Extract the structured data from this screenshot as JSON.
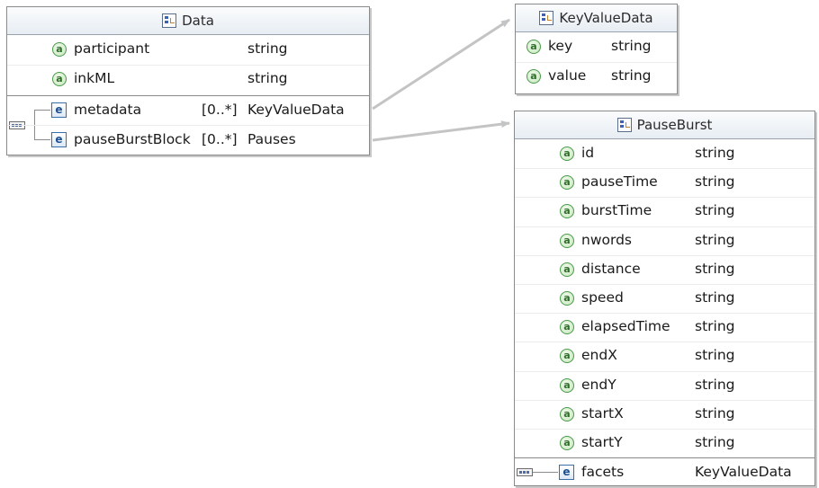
{
  "data_box": {
    "title": "Data",
    "attributes": [
      {
        "name": "participant",
        "type": "string"
      },
      {
        "name": "inkML",
        "type": "string"
      }
    ],
    "elements": [
      {
        "name": "metadata",
        "card": "[0..*]",
        "type": "KeyValueData"
      },
      {
        "name": "pauseBurstBlock",
        "card": "[0..*]",
        "type": "Pauses"
      }
    ]
  },
  "keyvalue_box": {
    "title": "KeyValueData",
    "attributes": [
      {
        "name": "key",
        "type": "string"
      },
      {
        "name": "value",
        "type": "string"
      }
    ]
  },
  "pauseburst_box": {
    "title": "PauseBurst",
    "attributes": [
      {
        "name": "id",
        "type": "string"
      },
      {
        "name": "pauseTime",
        "type": "string"
      },
      {
        "name": "burstTime",
        "type": "string"
      },
      {
        "name": "nwords",
        "type": "string"
      },
      {
        "name": "distance",
        "type": "string"
      },
      {
        "name": "speed",
        "type": "string"
      },
      {
        "name": "elapsedTime",
        "type": "string"
      },
      {
        "name": "endX",
        "type": "string"
      },
      {
        "name": "endY",
        "type": "string"
      },
      {
        "name": "startX",
        "type": "string"
      },
      {
        "name": "startY",
        "type": "string"
      }
    ],
    "elements": [
      {
        "name": "facets",
        "type": "KeyValueData"
      }
    ]
  },
  "icons": {
    "attribute": "a",
    "element": "e"
  },
  "colors": {
    "connector": "#c4c4c4",
    "attribute_icon": "#4a9a4a",
    "element_icon": "#3a6ea8"
  }
}
